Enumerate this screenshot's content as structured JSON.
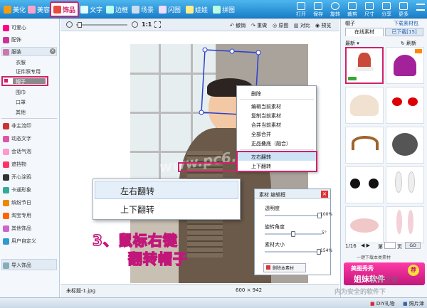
{
  "toolbar": {
    "tabs": [
      {
        "label": "美化",
        "color": "#f39c12"
      },
      {
        "label": "美容",
        "color": "#e74c8c"
      },
      {
        "label": "饰品",
        "color": "#e74c3c",
        "active": true
      },
      {
        "label": "文字",
        "color": "#3498db"
      },
      {
        "label": "边框",
        "color": "#1abc9c"
      },
      {
        "label": "场景",
        "color": "#2980b9"
      },
      {
        "label": "闪图",
        "color": "#8e44ad"
      },
      {
        "label": "娃娃",
        "color": "#f1c40f"
      },
      {
        "label": "拼图",
        "color": "#16a085"
      }
    ],
    "tools": [
      "打开",
      "保存",
      "旋转",
      "裁剪",
      "尺寸",
      "分享",
      "更多"
    ],
    "menu_icon": "menu-icon"
  },
  "left_panel": {
    "items_top": [
      "可爱心",
      "配饰"
    ],
    "category": "服装",
    "sub_items": [
      "衣服",
      "证件照专用",
      "帽子",
      "围巾",
      "口罩",
      "其他"
    ],
    "selected_sub": "帽子",
    "items_bottom": [
      "非主流印",
      "动态文字",
      "会话气泡",
      "遮挡物",
      "开心涂鸦",
      "卡通形象",
      "缤纷节日",
      "淘宝专用",
      "其他饰品",
      "用户自定义"
    ],
    "import_label": "导入饰品"
  },
  "canvas": {
    "zoom_label": "1:1",
    "actions": [
      "撤销",
      "重做",
      "原图",
      "对比",
      "预览"
    ],
    "filename": "未标题-1.jpg",
    "dimensions": "600 × 942",
    "watermark": "www.pc6.com"
  },
  "context_menu": {
    "items": [
      "删除",
      "编辑当前素材",
      "复制当前素材",
      "合并当前素材",
      "全部合并",
      "正品叠底（融合）",
      "左右翻转",
      "上下翻转"
    ]
  },
  "zoom_menu": {
    "items": [
      "左右翻转",
      "上下翻转"
    ]
  },
  "material_panel": {
    "title": "素材 编辑框",
    "transparency_label": "透明度",
    "transparency_value": "100%",
    "transparency": 1.0,
    "rotation_label": "旋转角度",
    "rotation_value": "5°",
    "rotation": 0.5,
    "size_label": "素材大小",
    "size_value": "154%",
    "size": 0.98,
    "delete_label": "删除本素材"
  },
  "annotation": {
    "line1": "3、鼠标右键",
    "line2": "翻转帽子"
  },
  "right_panel": {
    "section_title": "帽子",
    "download_link": "下载素材包",
    "tabs": [
      "在线素材",
      "已下载[15]"
    ],
    "sort_label": "最新",
    "refresh_label": "刷新",
    "page_current": "1/16",
    "page_label": "第",
    "page_unit": "页",
    "go_label": "GO",
    "promo_text": "一键下载本类素材",
    "promo_brand": "美图秀秀",
    "promo_name": "姐妹软件",
    "promo_tag": "荐"
  },
  "bottom_bar": {
    "right_text": "照片津",
    "left_text": "DIY礼物",
    "site_watermark": "系统之家",
    "secure_text": "内为安全的软件下"
  }
}
